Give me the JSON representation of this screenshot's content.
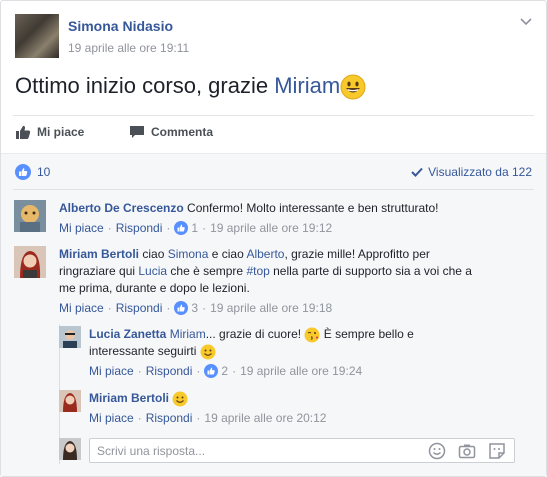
{
  "post": {
    "author": "Simona Nidasio",
    "timestamp": "19 aprile alle ore 19:11",
    "text_before": "Ottimo inizio corso, grazie ",
    "mention": "Miriam",
    "emoji": "grinning-face",
    "actions": {
      "like": "Mi piace",
      "comment": "Commenta"
    }
  },
  "stats": {
    "likes": "10",
    "seen": "Visualizzato da 122"
  },
  "comments": [
    {
      "author": "Alberto De Crescenzo",
      "text": "Confermo! Molto interessante e ben strutturato!",
      "like": "Mi piace",
      "reply": "Rispondi",
      "reactions": "1",
      "time": "19 aprile alle ore 19:12"
    },
    {
      "author": "Miriam Bertoli",
      "t1": "ciao ",
      "m1": "Simona",
      "t2": " e ciao ",
      "m2": "Alberto",
      "t3": ", grazie mille! Approfitto per",
      "l2a": "ringraziare qui ",
      "m3": "Lucia",
      "l2b": " che è sempre ",
      "tag": "#top",
      "l2c": " nella parte di supporto sia a voi che a",
      "l3": "me prima, durante e dopo le lezioni.",
      "like": "Mi piace",
      "reply": "Rispondi",
      "reactions": "3",
      "time": "19 aprile alle ore 19:18"
    }
  ],
  "replies": [
    {
      "author": "Lucia Zanetta",
      "mention": "Miriam",
      "t1": "... grazie di cuore! ",
      "t2": " È sempre bello e",
      "l2": "interessante seguirti ",
      "like": "Mi piace",
      "reply": "Rispondi",
      "reactions": "2",
      "time": "19 aprile alle ore 19:24"
    },
    {
      "author": "Miriam Bertoli",
      "like": "Mi piace",
      "reply": "Rispondi",
      "time": "19 aprile alle ore 20:12"
    }
  ],
  "reply_input": {
    "placeholder": "Scrivi una risposta..."
  },
  "colors": {
    "link": "#365899",
    "meta": "#90949c",
    "like_blue": "#5890ff",
    "emoji_yellow": "#f7c92a"
  }
}
